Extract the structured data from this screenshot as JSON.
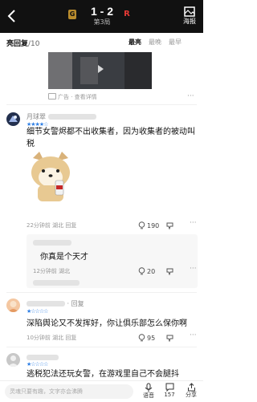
{
  "header": {
    "back_icon": "chevron-left-icon",
    "score": "1 - 2",
    "game_no": "第3局",
    "team_a_badge": "G",
    "team_b_badge": "R",
    "poster_label": "海报",
    "colors": {
      "bar_bg": "#111111",
      "accent_blue": "#2e7fe5",
      "team_b": "#e53935"
    }
  },
  "section": {
    "title": "亮回复",
    "count": "/10",
    "sort_tabs": [
      "最亮",
      "最晚",
      "最早"
    ],
    "active_sort": "最亮"
  },
  "ad": {
    "text": "广告 · 查看详情",
    "more": "···"
  },
  "comments": [
    {
      "user": "月球翠",
      "text": "细节女警烬都不出收集者，因为收集者的被动叫税",
      "meta": "22分钟前 湖北 回复",
      "likes": "190",
      "more": "···"
    },
    {
      "text": "你真是个天才",
      "meta": "12分钟前 湖北",
      "likes": "20",
      "more": "···"
    },
    {
      "user_suffix": "· 回复",
      "text": "深陷舆论又不发挥好，你让俱乐部怎么保你啊",
      "meta": "10分钟前 湖北 回复",
      "likes": "95",
      "more": "···"
    },
    {
      "text": "逃税犯法还玩女警，在游戏里自己不会腿抖"
    }
  ],
  "bottom": {
    "input_placeholder": "灵魂只要有趣，文字亦会沸腾",
    "voice_label": "语音",
    "comment_count": "157",
    "share_label": "分享"
  }
}
